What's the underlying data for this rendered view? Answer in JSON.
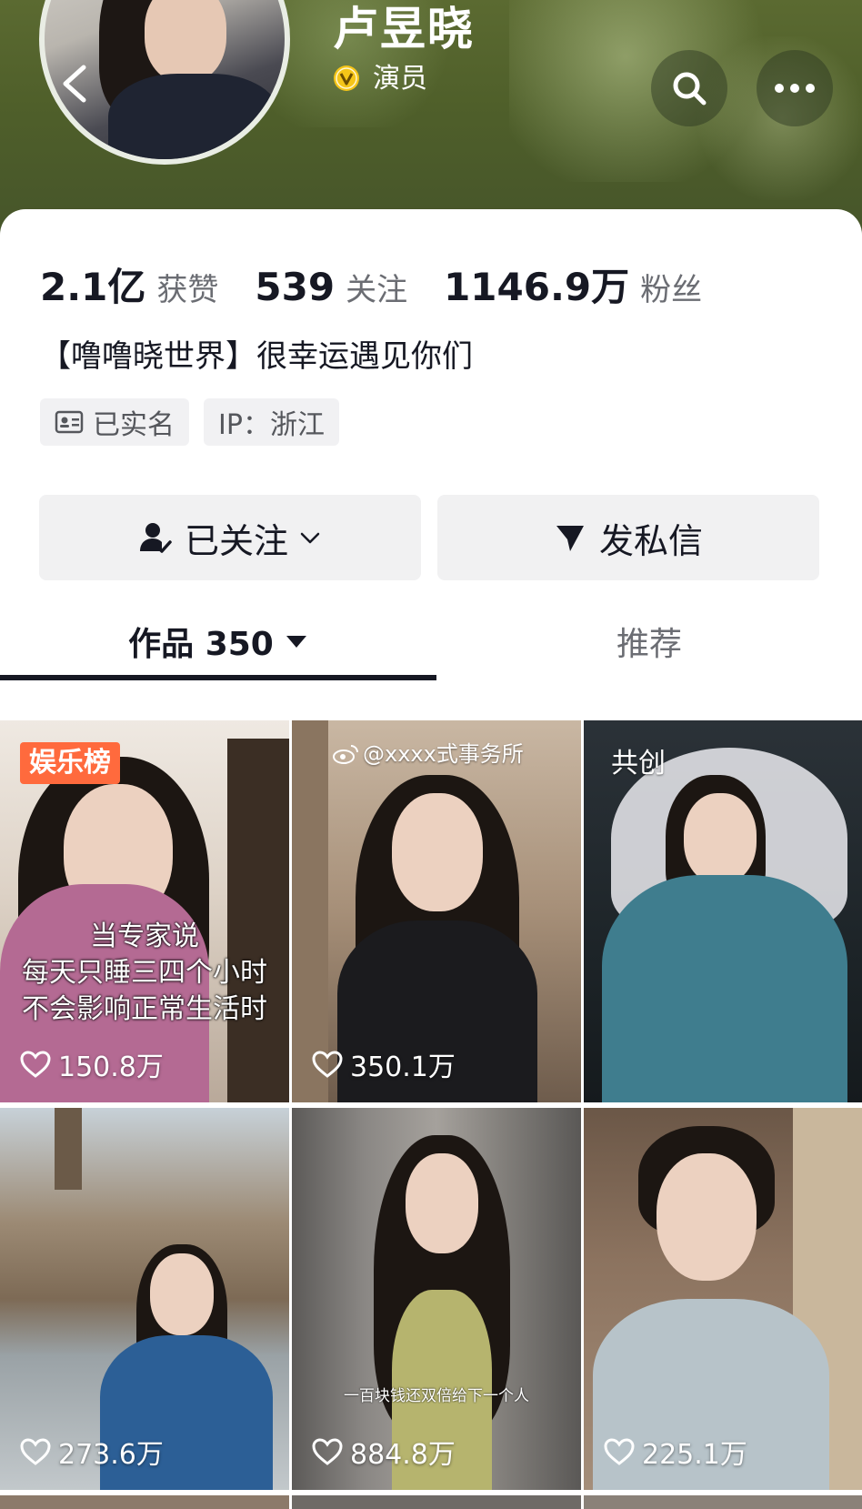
{
  "profile": {
    "name": "卢昱晓",
    "role": "演员"
  },
  "stats": [
    {
      "value": "2.1亿",
      "label": "获赞"
    },
    {
      "value": "539",
      "label": "关注"
    },
    {
      "value": "1146.9万",
      "label": "粉丝"
    }
  ],
  "bio": "【噜噜晓世界】很幸运遇见你们",
  "tags": {
    "verified": "已实名",
    "ip": "IP：浙江"
  },
  "actions": {
    "follow": "已关注",
    "message": "发私信"
  },
  "tabs": {
    "works": "作品 350",
    "recommend": "推荐"
  },
  "videos": [
    {
      "likes": "150.8万",
      "badge": "娱乐榜",
      "caption": [
        "当专家说",
        "每天只睡三四个小时",
        "不会影响正常生活时"
      ]
    },
    {
      "likes": "350.1万",
      "watermark": "@xxxx式事务所"
    },
    {
      "likes": "",
      "badge": "共创"
    },
    {
      "likes": "273.6万"
    },
    {
      "likes": "884.8万",
      "caption": "一百块钱还双倍给下一个人"
    },
    {
      "likes": "225.1万"
    }
  ],
  "colors": {
    "header_green": "#4f5f2a",
    "badge_orange": "#ff6a3d",
    "verify_gold": "#f5c518"
  }
}
